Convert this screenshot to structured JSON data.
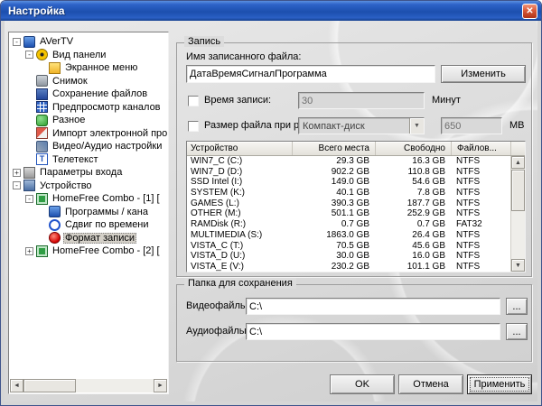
{
  "window": {
    "title": "Настройка"
  },
  "icons": {
    "close": "✕",
    "dropdown": "▼",
    "up": "▲",
    "down": "▼",
    "left": "◄",
    "right": "►",
    "plus": "+",
    "minus": "-"
  },
  "colors": {
    "titlebar_blue": "#2a5fc4",
    "close_button_red": "#c74634",
    "record_dot_red": "#d40000",
    "selection_gray": "#d4d0c8"
  },
  "tree": {
    "items": [
      {
        "label": "AVerTV",
        "level": 0,
        "icon": "tv-icon",
        "expand": "minus"
      },
      {
        "label": "Вид панели",
        "level": 1,
        "icon": "panel-view-icon",
        "expand": "minus"
      },
      {
        "label": "Экранное меню",
        "level": 2,
        "icon": "osd-menu-icon",
        "expand": "none"
      },
      {
        "label": "Снимок",
        "level": 1,
        "icon": "snapshot-icon",
        "expand": "none"
      },
      {
        "label": "Сохранение файлов",
        "level": 1,
        "icon": "save-files-icon",
        "expand": "none"
      },
      {
        "label": "Предпросмотр каналов",
        "level": 1,
        "icon": "channel-preview-icon",
        "expand": "none"
      },
      {
        "label": "Разное",
        "level": 1,
        "icon": "misc-icon",
        "expand": "none"
      },
      {
        "label": "Импорт электронной прог",
        "level": 1,
        "icon": "epg-import-icon",
        "expand": "none"
      },
      {
        "label": "Видео/Аудио настройки",
        "level": 1,
        "icon": "av-settings-icon",
        "expand": "none"
      },
      {
        "label": "Телетекст",
        "level": 1,
        "icon": "teletext-icon",
        "expand": "none"
      },
      {
        "label": "Параметры входа",
        "level": 0,
        "icon": "input-settings-icon",
        "expand": "plus"
      },
      {
        "label": "Устройство",
        "level": 0,
        "icon": "device-icon",
        "expand": "minus"
      },
      {
        "label": "HomeFree Combo - [1] [",
        "level": 1,
        "icon": "tuner-icon",
        "expand": "minus"
      },
      {
        "label": "Программы / кана",
        "level": 2,
        "icon": "programs-icon",
        "expand": "none"
      },
      {
        "label": "Сдвиг по времени",
        "level": 2,
        "icon": "timeshift-icon",
        "expand": "none"
      },
      {
        "label": "Формат записи",
        "level": 2,
        "icon": "record-format-icon",
        "expand": "none",
        "selected": true
      },
      {
        "label": "HomeFree Combo - [2] [",
        "level": 1,
        "icon": "tuner-icon",
        "expand": "plus"
      }
    ]
  },
  "recording": {
    "group_title": "Запись",
    "filename_label": "Имя записанного файла:",
    "filename_value": "ДатаВремяСигналПрограмма",
    "change_button": "Изменить",
    "time_checkbox": "Время записи:",
    "time_value": "30",
    "time_unit": "Минут",
    "split_checkbox": "Размер файла при разбиении:",
    "split_preset": "Компакт-диск",
    "split_size": "650",
    "split_unit": "MB",
    "table": {
      "columns": [
        "Устройство",
        "Всего места",
        "Свободно",
        "Файлов..."
      ],
      "rows": [
        [
          "WIN7_C (C:)",
          "29.3 GB",
          "16.3 GB",
          "NTFS"
        ],
        [
          "WIN7_D (D:)",
          "902.2 GB",
          "110.8 GB",
          "NTFS"
        ],
        [
          "SSD Intel (I:)",
          "149.0 GB",
          "54.6 GB",
          "NTFS"
        ],
        [
          "SYSTEM (K:)",
          "40.1 GB",
          "7.8 GB",
          "NTFS"
        ],
        [
          "GAMES (L:)",
          "390.3 GB",
          "187.7 GB",
          "NTFS"
        ],
        [
          "OTHER (M:)",
          "501.1 GB",
          "252.9 GB",
          "NTFS"
        ],
        [
          "RAMDisk (R:)",
          "0.7 GB",
          "0.7 GB",
          "FAT32"
        ],
        [
          "MULTIMEDIA (S:)",
          "1863.0 GB",
          "26.4 GB",
          "NTFS"
        ],
        [
          "VISTA_C (T:)",
          "70.5 GB",
          "45.6 GB",
          "NTFS"
        ],
        [
          "VISTA_D (U:)",
          "30.0 GB",
          "16.0 GB",
          "NTFS"
        ],
        [
          "VISTA_E (V:)",
          "230.2 GB",
          "101.1 GB",
          "NTFS"
        ]
      ]
    }
  },
  "folders": {
    "group_title": "Папка для сохранения",
    "video_label": "Видеофайлы:",
    "video_value": "C:\\",
    "audio_label": "Аудиофайлы:",
    "audio_value": "C:\\",
    "browse_label": "..."
  },
  "footer": {
    "ok": "OK",
    "cancel": "Отмена",
    "apply": "Применить"
  }
}
